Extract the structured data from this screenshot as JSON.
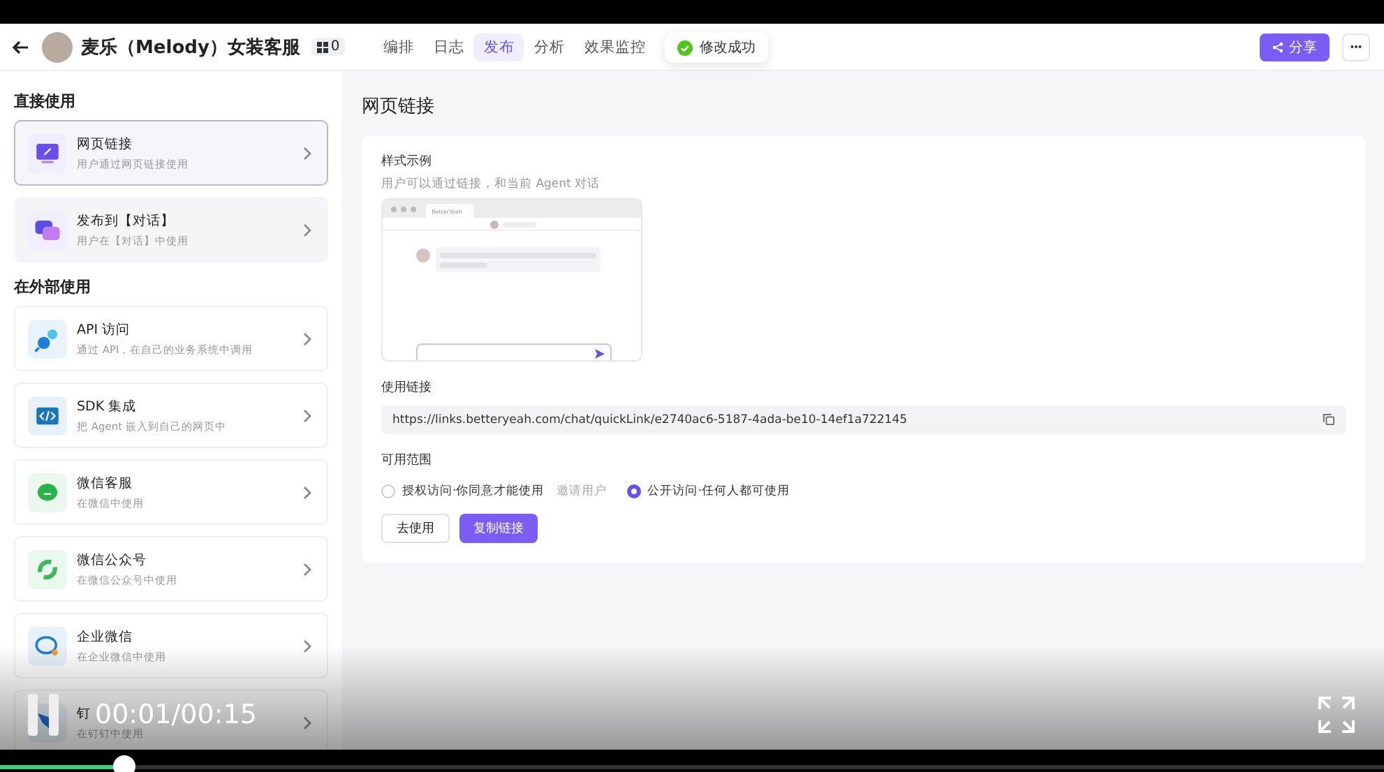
{
  "header": {
    "title": "麦乐（Melody）女装客服",
    "badge": "0",
    "tabs": [
      {
        "label": "编排",
        "selected": false
      },
      {
        "label": "日志",
        "selected": false
      },
      {
        "label": "发布",
        "selected": true
      },
      {
        "label": "分析",
        "selected": false
      },
      {
        "label": "效果监控",
        "selected": false
      }
    ],
    "toast": "修改成功",
    "share_button": "分享"
  },
  "sidebar": {
    "sections": [
      {
        "heading": "直接使用",
        "items": [
          {
            "kind": "web",
            "title": "网页链接",
            "subtitle": "用户通过网页链接使用",
            "selected": true
          },
          {
            "kind": "chat",
            "title": "发布到【对话】",
            "subtitle": "用户在【对话】中使用",
            "selected": false
          }
        ]
      },
      {
        "heading": "在外部使用",
        "items": [
          {
            "kind": "api",
            "title": "API 访问",
            "subtitle": "通过 API，在自己的业务系统中调用",
            "selected": false
          },
          {
            "kind": "sdk",
            "title": "SDK 集成",
            "subtitle": "把 Agent 嵌入到自己的网页中",
            "selected": false
          },
          {
            "kind": "wechat",
            "title": "微信客服",
            "subtitle": "在微信中使用",
            "selected": false
          },
          {
            "kind": "official",
            "title": "微信公众号",
            "subtitle": "在微信公众号中使用",
            "selected": false
          },
          {
            "kind": "wecom",
            "title": "企业微信",
            "subtitle": "在企业微信中使用",
            "selected": false
          },
          {
            "kind": "ding",
            "title": "钉",
            "subtitle": "在钉钉中使用",
            "selected": false
          }
        ]
      }
    ]
  },
  "main": {
    "title": "网页链接",
    "preview": {
      "heading": "样式示例",
      "description": "用户可以通过链接，和当前 Agent 对话",
      "brand": "BetterYeah"
    },
    "link": {
      "label": "使用链接",
      "url": "https://links.betteryeah.com/chat/quickLink/e2740ac6-5187-4ada-be10-14ef1a722145"
    },
    "scope": {
      "label": "可用范围",
      "options": [
        {
          "label": "授权访问·你同意才能使用",
          "extra": "邀请用户",
          "selected": false
        },
        {
          "label": "公开访问·任何人都可使用",
          "selected": true
        }
      ]
    },
    "buttons": [
      {
        "kind": "secondary",
        "label": "去使用"
      },
      {
        "kind": "primary",
        "label": "复制链接"
      }
    ]
  },
  "video": {
    "playing": true,
    "time": "00:01/00:15",
    "level": 0.09
  }
}
